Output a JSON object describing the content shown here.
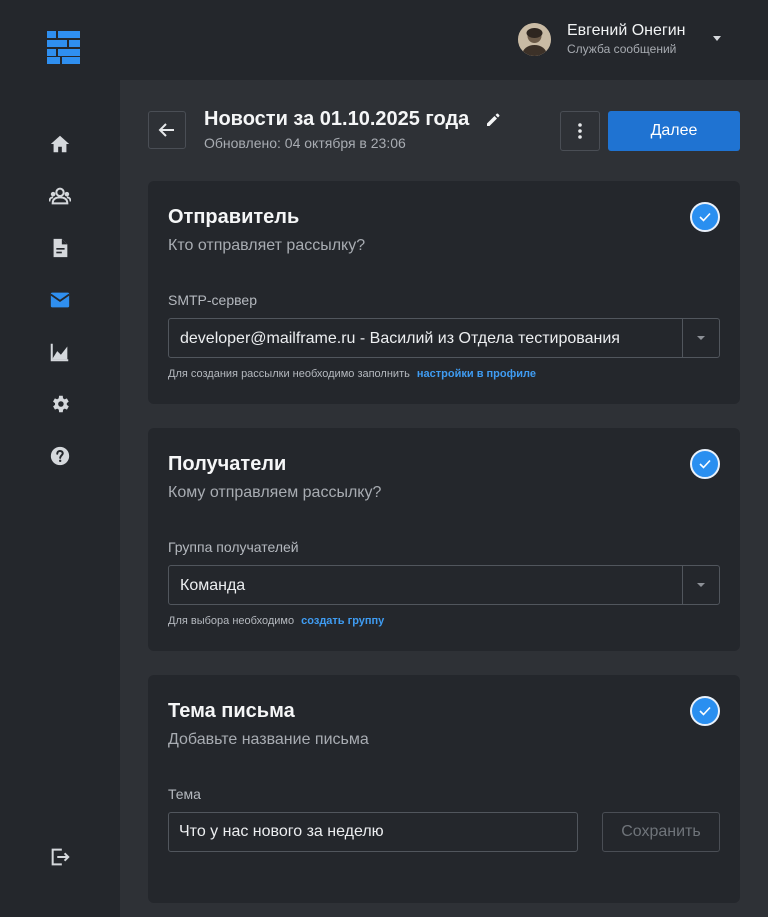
{
  "header": {
    "user_name": "Евгений Онегин",
    "user_role": "Служба сообщений"
  },
  "sidebar": {
    "items": [
      {
        "icon": "home-icon",
        "active": false
      },
      {
        "icon": "contacts-icon",
        "active": false
      },
      {
        "icon": "document-icon",
        "active": false
      },
      {
        "icon": "mail-icon",
        "active": true
      },
      {
        "icon": "analytics-icon",
        "active": false
      },
      {
        "icon": "settings-icon",
        "active": false
      },
      {
        "icon": "help-icon",
        "active": false
      }
    ],
    "logout_icon": "logout-icon"
  },
  "page": {
    "title": "Новости за 01.10.2025 года",
    "updated": "Обновлено: 04 октября в 23:06",
    "next_label": "Далее"
  },
  "sender": {
    "title": "Отправитель",
    "subtitle": "Кто отправляет рассылку?",
    "field_label": "SMTP-сервер",
    "value": "developer@mailframe.ru - Василий из Отдела тестирования",
    "hint": "Для создания рассылки необходимо заполнить",
    "hint_link": "настройки в профиле"
  },
  "recipients": {
    "title": "Получатели",
    "subtitle": "Кому отправляем рассылку?",
    "field_label": "Группа получателей",
    "value": "Команда",
    "hint": "Для выбора необходимо",
    "hint_link": "создать группу"
  },
  "subject": {
    "title": "Тема письма",
    "subtitle": "Добавьте название письма",
    "field_label": "Тема",
    "value": "Что у нас нового за неделю",
    "save_label": "Сохранить"
  },
  "colors": {
    "accent": "#1f73d2",
    "check": "#2a8ff0",
    "link": "#3f9cf2",
    "active_icon": "#2f8ff0",
    "icon": "#d5d8dc"
  }
}
